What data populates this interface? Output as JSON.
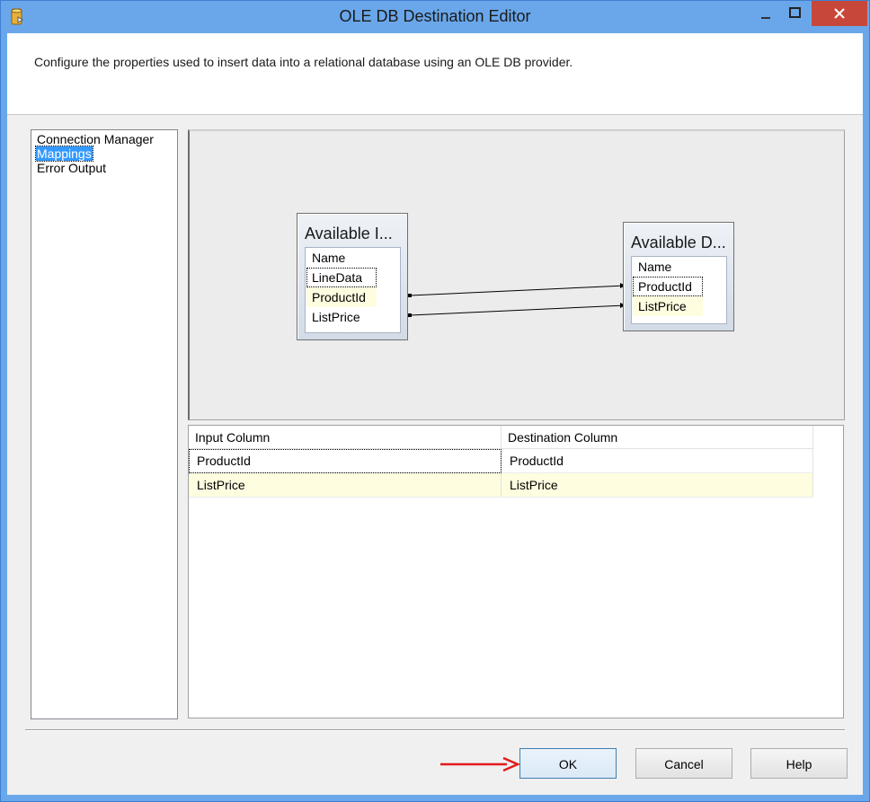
{
  "window": {
    "title": "OLE DB Destination Editor",
    "description": "Configure the properties used to insert data into a relational database using an OLE DB provider."
  },
  "nav": {
    "items": [
      "Connection Manager",
      "Mappings",
      "Error Output"
    ],
    "selected": "Mappings"
  },
  "diagram": {
    "input_table": {
      "title": "Available I...",
      "header": "Name",
      "rows": [
        "LineData",
        "ProductId",
        "ListPrice"
      ]
    },
    "dest_table": {
      "title": "Available D...",
      "header": "Name",
      "rows": [
        "ProductId",
        "ListPrice"
      ]
    }
  },
  "grid": {
    "columns": [
      "Input Column",
      "Destination Column"
    ],
    "rows": [
      [
        "ProductId",
        "ProductId"
      ],
      [
        "ListPrice",
        "ListPrice"
      ]
    ]
  },
  "buttons": {
    "ok": "OK",
    "cancel": "Cancel",
    "help": "Help"
  },
  "colors": {
    "title_bar": "#6aa7ea",
    "close_button": "#c7483b",
    "selection": "#3399ff",
    "highlight_row": "#fffde0",
    "annotation_arrow": "#e21b1b"
  }
}
